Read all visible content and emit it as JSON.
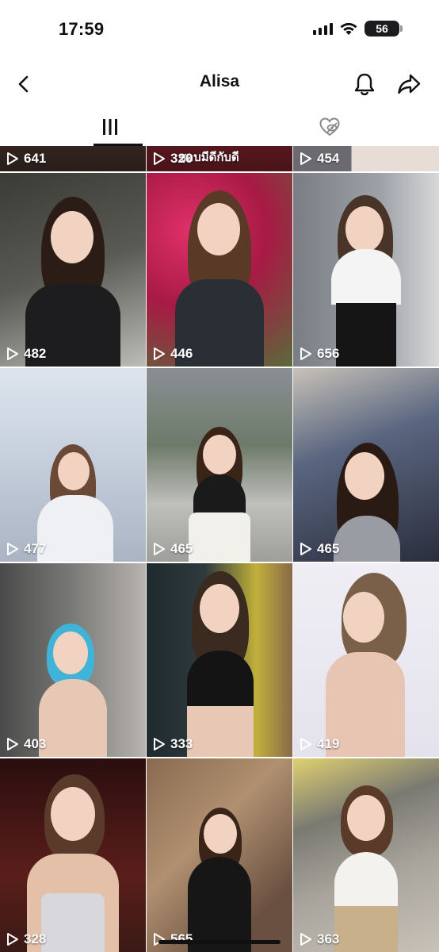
{
  "status_bar": {
    "time": "17:59",
    "battery": "56"
  },
  "header": {
    "title": "Alisa"
  },
  "tabs": [
    {
      "label": "videos",
      "icon": "grid-icon",
      "active": true
    },
    {
      "label": "liked",
      "icon": "heart-hidden-icon",
      "active": false
    }
  ],
  "videos": [
    {
      "views": "641"
    },
    {
      "views": "320",
      "caption": "ชอบมีดีกับดี"
    },
    {
      "views": "454"
    },
    {
      "views": "482"
    },
    {
      "views": "446"
    },
    {
      "views": "656"
    },
    {
      "views": "477"
    },
    {
      "views": "465"
    },
    {
      "views": "465"
    },
    {
      "views": "403"
    },
    {
      "views": "333"
    },
    {
      "views": "419"
    },
    {
      "views": "328"
    },
    {
      "views": "565"
    },
    {
      "views": "363"
    }
  ],
  "colors": {
    "text": "#111111",
    "background": "#ffffff"
  }
}
